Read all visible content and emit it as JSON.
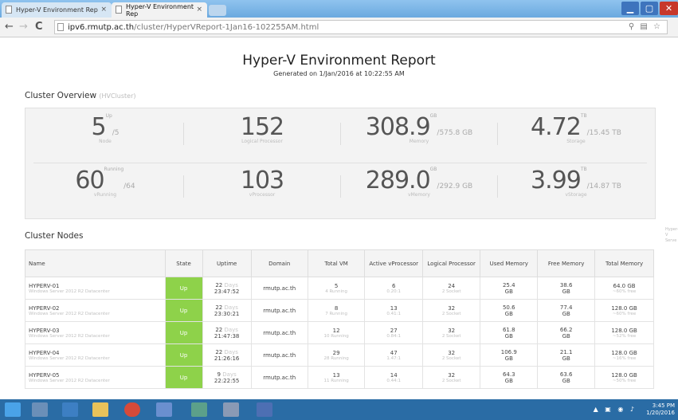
{
  "browser": {
    "tabs": [
      {
        "label": "Hyper-V Environment Rep"
      },
      {
        "label": "Hyper-V Environment Rep"
      }
    ],
    "url_host": "ipv6.rmutp.ac.th",
    "url_path": "/cluster/HyperVReport-1Jan16-102255AM.html",
    "window_controls": {
      "min": "▁",
      "max": "▢",
      "close": "✕"
    }
  },
  "report": {
    "title": "Hyper-V Environment Report",
    "subtitle": "Generated on 1/Jan/2016 at 10:22:55 AM"
  },
  "overview": {
    "heading": "Cluster Overview",
    "heading_muted": "(HVCluster)",
    "row1": [
      {
        "big": "5",
        "sup": "Up",
        "sm": "/5",
        "label": "Node"
      },
      {
        "big": "152",
        "sup": "",
        "sm": "",
        "label": "Logical Processor"
      },
      {
        "big": "308.9",
        "sup": "GB",
        "sm": "/575.8 GB",
        "label": "Memory"
      },
      {
        "big": "4.72",
        "sup": "TB",
        "sm": "/15.45 TB",
        "label": "Storage"
      }
    ],
    "row2": [
      {
        "big": "60",
        "sup": "Running",
        "sm": "/64",
        "label": "vRunning"
      },
      {
        "big": "103",
        "sup": "",
        "sm": "",
        "label": "vProcessor"
      },
      {
        "big": "289.0",
        "sup": "GB",
        "sm": "/292.9 GB",
        "label": "vMemory"
      },
      {
        "big": "3.99",
        "sup": "TB",
        "sm": "/14.87 TB",
        "label": "vStorage"
      }
    ]
  },
  "nodes": {
    "heading": "Cluster Nodes",
    "columns": [
      "Name",
      "State",
      "Uptime",
      "Domain",
      "Total VM",
      "Active vProcessor",
      "Logical Processor",
      "Used Memory",
      "Free Memory",
      "Total Memory"
    ],
    "rows": [
      {
        "name": "HYPERV-01",
        "os": "Windows Server 2012 R2 Datacenter",
        "state": "Up",
        "uptime_days": "22",
        "uptime_unit": "Days",
        "uptime_time": "23:47:52",
        "domain": "rmutp.ac.th",
        "vm": "5",
        "vm_sub": "4 Running",
        "vproc": "6",
        "vproc_sub": "0.20:1",
        "lproc": "24",
        "lproc_sub": "2 Socket",
        "used": "25.4",
        "used_unit": "GB",
        "free": "38.6",
        "free_unit": "GB",
        "total": "64.0 GB",
        "total_sub": "~60% free"
      },
      {
        "name": "HYPERV-02",
        "os": "Windows Server 2012 R2 Datacenter",
        "state": "Up",
        "uptime_days": "22",
        "uptime_unit": "Days",
        "uptime_time": "23:30:21",
        "domain": "rmutp.ac.th",
        "vm": "8",
        "vm_sub": "7 Running",
        "vproc": "13",
        "vproc_sub": "0.41:1",
        "lproc": "32",
        "lproc_sub": "2 Socket",
        "used": "50.6",
        "used_unit": "GB",
        "free": "77.4",
        "free_unit": "GB",
        "total": "128.0 GB",
        "total_sub": "~60% free"
      },
      {
        "name": "HYPERV-03",
        "os": "Windows Server 2012 R2 Datacenter",
        "state": "Up",
        "uptime_days": "22",
        "uptime_unit": "Days",
        "uptime_time": "21:47:38",
        "domain": "rmutp.ac.th",
        "vm": "12",
        "vm_sub": "10 Running",
        "vproc": "27",
        "vproc_sub": "0.84:1",
        "lproc": "32",
        "lproc_sub": "2 Socket",
        "used": "61.8",
        "used_unit": "GB",
        "free": "66.2",
        "free_unit": "GB",
        "total": "128.0 GB",
        "total_sub": "~52% free"
      },
      {
        "name": "HYPERV-04",
        "os": "Windows Server 2012 R2 Datacenter",
        "state": "Up",
        "uptime_days": "22",
        "uptime_unit": "Days",
        "uptime_time": "21:26:16",
        "domain": "rmutp.ac.th",
        "vm": "29",
        "vm_sub": "28 Running",
        "vproc": "47",
        "vproc_sub": "1.47:1",
        "lproc": "32",
        "lproc_sub": "2 Socket",
        "used": "106.9",
        "used_unit": "GB",
        "free": "21.1",
        "free_unit": "GB",
        "total": "128.0 GB",
        "total_sub": "~16% free"
      },
      {
        "name": "HYPERV-05",
        "os": "Windows Server 2012 R2 Datacenter",
        "state": "Up",
        "uptime_days": "9",
        "uptime_unit": "Days",
        "uptime_time": "22:22:55",
        "domain": "rmutp.ac.th",
        "vm": "13",
        "vm_sub": "11 Running",
        "vproc": "14",
        "vproc_sub": "0.44:1",
        "lproc": "32",
        "lproc_sub": "2 Socket",
        "used": "64.3",
        "used_unit": "GB",
        "free": "63.6",
        "free_unit": "GB",
        "total": "128.0 GB",
        "total_sub": "~50% free"
      }
    ]
  },
  "side_note": "Hyper-V Serve",
  "taskbar": {
    "time": "3:45 PM",
    "date": "1/20/2016"
  },
  "colors": {
    "accent_green": "#8ed24a",
    "taskbar": "#2a6ca5",
    "titlebar": "#6ba9df"
  }
}
